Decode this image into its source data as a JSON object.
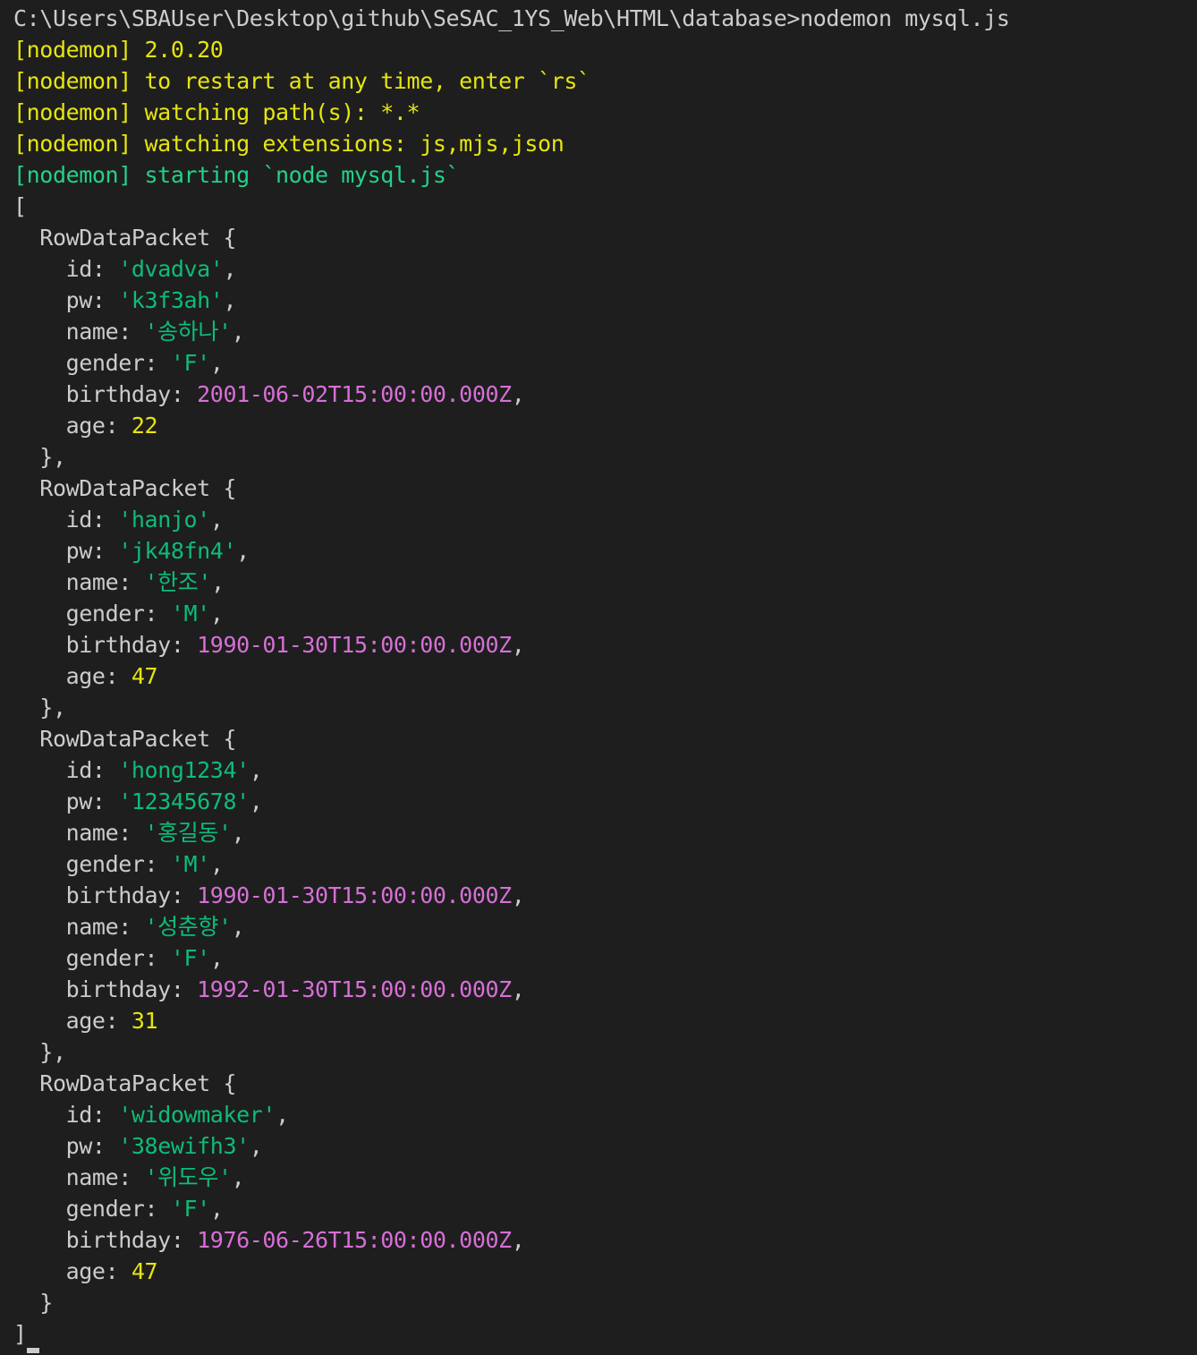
{
  "colors": {
    "background": "#1e1e1e",
    "default_text": "#cccccc",
    "nodemon_yellow": "#e5e510",
    "nodemon_green": "#23d18b",
    "string_green": "#0dbc79",
    "date_magenta": "#d670d6",
    "number_yellow": "#e5e510"
  },
  "terminal": {
    "lines": [
      {
        "type": "text",
        "color": "c-default",
        "text": "C:\\Users\\SBAUser\\Desktop\\github\\SeSAC_1YS_Web\\HTML\\database>nodemon mysql.js"
      },
      {
        "type": "text",
        "color": "c-yellow",
        "text": "[nodemon] 2.0.20"
      },
      {
        "type": "text",
        "color": "c-yellow",
        "text": "[nodemon] to restart at any time, enter `rs`"
      },
      {
        "type": "text",
        "color": "c-yellow",
        "text": "[nodemon] watching path(s): *.*"
      },
      {
        "type": "text",
        "color": "c-yellow",
        "text": "[nodemon] watching extensions: js,mjs,json"
      },
      {
        "type": "text",
        "color": "c-green",
        "text": "[nodemon] starting `node mysql.js`"
      },
      {
        "type": "text",
        "color": "c-default",
        "text": "["
      },
      {
        "type": "text",
        "color": "c-default",
        "text": "  RowDataPacket {"
      },
      {
        "type": "prop",
        "indent": "    ",
        "key": "id",
        "value": "'dvadva'",
        "vtype": "c-strgreen",
        "suffix": ","
      },
      {
        "type": "prop",
        "indent": "    ",
        "key": "pw",
        "value": "'k3f3ah'",
        "vtype": "c-strgreen",
        "suffix": ","
      },
      {
        "type": "prop",
        "indent": "    ",
        "key": "name",
        "value": "'송하나'",
        "vtype": "c-strgreen",
        "suffix": ","
      },
      {
        "type": "prop",
        "indent": "    ",
        "key": "gender",
        "value": "'F'",
        "vtype": "c-strgreen",
        "suffix": ","
      },
      {
        "type": "prop",
        "indent": "    ",
        "key": "birthday",
        "value": "2001-06-02T15:00:00.000Z",
        "vtype": "c-magenta",
        "suffix": ","
      },
      {
        "type": "prop",
        "indent": "    ",
        "key": "age",
        "value": "22",
        "vtype": "c-num",
        "suffix": ""
      },
      {
        "type": "text",
        "color": "c-default",
        "text": "  },"
      },
      {
        "type": "text",
        "color": "c-default",
        "text": "  RowDataPacket {"
      },
      {
        "type": "prop",
        "indent": "    ",
        "key": "id",
        "value": "'hanjo'",
        "vtype": "c-strgreen",
        "suffix": ","
      },
      {
        "type": "prop",
        "indent": "    ",
        "key": "pw",
        "value": "'jk48fn4'",
        "vtype": "c-strgreen",
        "suffix": ","
      },
      {
        "type": "prop",
        "indent": "    ",
        "key": "name",
        "value": "'한조'",
        "vtype": "c-strgreen",
        "suffix": ","
      },
      {
        "type": "prop",
        "indent": "    ",
        "key": "gender",
        "value": "'M'",
        "vtype": "c-strgreen",
        "suffix": ","
      },
      {
        "type": "prop",
        "indent": "    ",
        "key": "birthday",
        "value": "1990-01-30T15:00:00.000Z",
        "vtype": "c-magenta",
        "suffix": ","
      },
      {
        "type": "prop",
        "indent": "    ",
        "key": "age",
        "value": "47",
        "vtype": "c-num",
        "suffix": ""
      },
      {
        "type": "text",
        "color": "c-default",
        "text": "  },"
      },
      {
        "type": "text",
        "color": "c-default",
        "text": "  RowDataPacket {"
      },
      {
        "type": "prop",
        "indent": "    ",
        "key": "id",
        "value": "'hong1234'",
        "vtype": "c-strgreen",
        "suffix": ","
      },
      {
        "type": "prop",
        "indent": "    ",
        "key": "pw",
        "value": "'12345678'",
        "vtype": "c-strgreen",
        "suffix": ","
      },
      {
        "type": "prop",
        "indent": "    ",
        "key": "name",
        "value": "'홍길동'",
        "vtype": "c-strgreen",
        "suffix": ","
      },
      {
        "type": "prop",
        "indent": "    ",
        "key": "gender",
        "value": "'M'",
        "vtype": "c-strgreen",
        "suffix": ","
      },
      {
        "type": "prop",
        "indent": "    ",
        "key": "birthday",
        "value": "1990-01-30T15:00:00.000Z",
        "vtype": "c-magenta",
        "suffix": ","
      },
      {
        "type": "prop",
        "indent": "    ",
        "key": "name",
        "value": "'성춘향'",
        "vtype": "c-strgreen",
        "suffix": ","
      },
      {
        "type": "prop",
        "indent": "    ",
        "key": "gender",
        "value": "'F'",
        "vtype": "c-strgreen",
        "suffix": ","
      },
      {
        "type": "prop",
        "indent": "    ",
        "key": "birthday",
        "value": "1992-01-30T15:00:00.000Z",
        "vtype": "c-magenta",
        "suffix": ","
      },
      {
        "type": "prop",
        "indent": "    ",
        "key": "age",
        "value": "31",
        "vtype": "c-num",
        "suffix": ""
      },
      {
        "type": "text",
        "color": "c-default",
        "text": "  },"
      },
      {
        "type": "text",
        "color": "c-default",
        "text": "  RowDataPacket {"
      },
      {
        "type": "prop",
        "indent": "    ",
        "key": "id",
        "value": "'widowmaker'",
        "vtype": "c-strgreen",
        "suffix": ","
      },
      {
        "type": "prop",
        "indent": "    ",
        "key": "pw",
        "value": "'38ewifh3'",
        "vtype": "c-strgreen",
        "suffix": ","
      },
      {
        "type": "prop",
        "indent": "    ",
        "key": "name",
        "value": "'위도우'",
        "vtype": "c-strgreen",
        "suffix": ","
      },
      {
        "type": "prop",
        "indent": "    ",
        "key": "gender",
        "value": "'F'",
        "vtype": "c-strgreen",
        "suffix": ","
      },
      {
        "type": "prop",
        "indent": "    ",
        "key": "birthday",
        "value": "1976-06-26T15:00:00.000Z",
        "vtype": "c-magenta",
        "suffix": ","
      },
      {
        "type": "prop",
        "indent": "    ",
        "key": "age",
        "value": "47",
        "vtype": "c-num",
        "suffix": ""
      },
      {
        "type": "text",
        "color": "c-default",
        "text": "  }"
      },
      {
        "type": "cursorline",
        "color": "c-default",
        "text": "]"
      }
    ]
  }
}
